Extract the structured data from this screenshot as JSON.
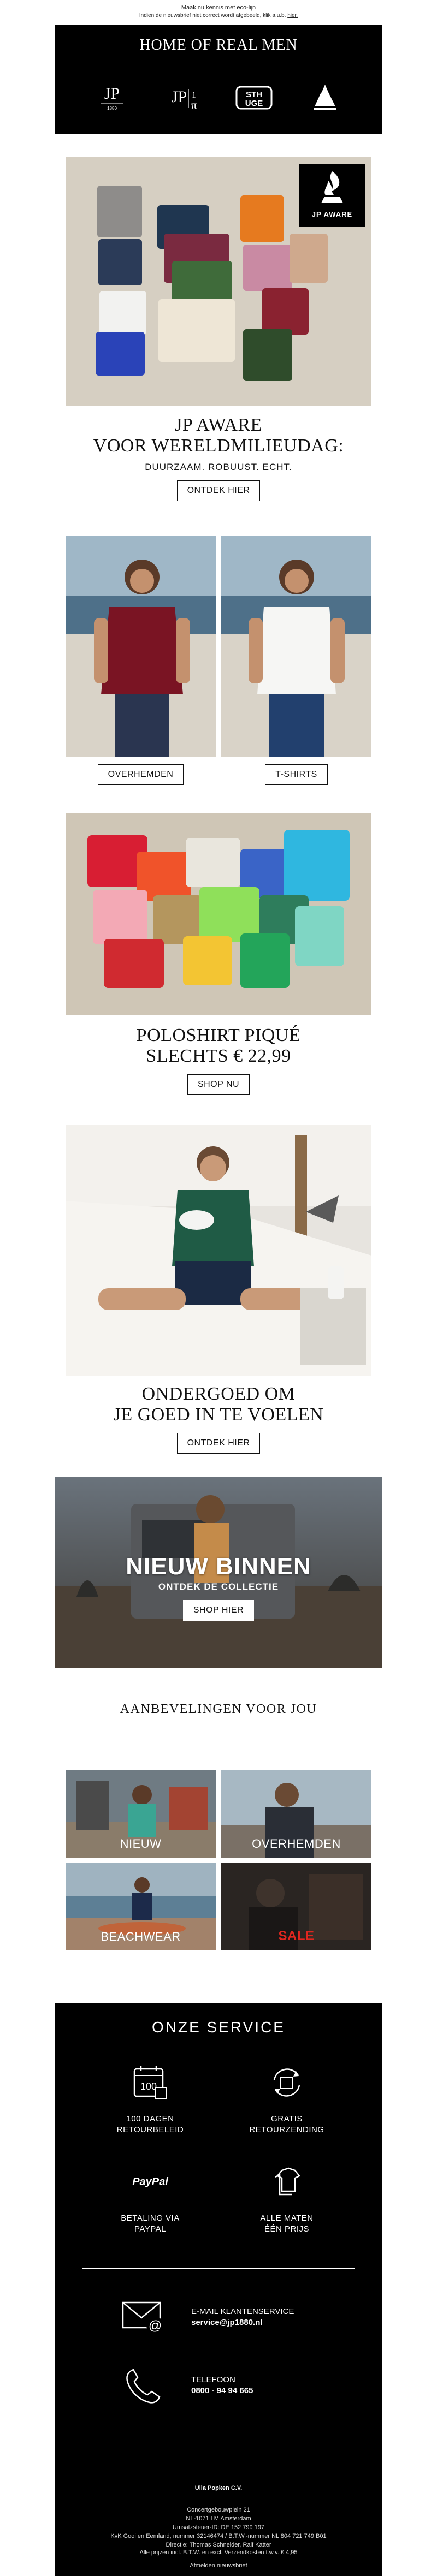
{
  "topbar": {
    "line1": "Maak nu kennis met eco-lijn",
    "line2_prefix": "Indien de nieuwsbrief niet correct wordt afgebeeld, klik a.u.b.",
    "line2_link": "hier."
  },
  "header": {
    "brand": "HOME OF REAL MEN",
    "logos": [
      "JP 1880",
      "JP π",
      "STHUGE",
      "JP AWARE"
    ]
  },
  "promo_aware": {
    "badge": "JP AWARE",
    "title_line1": "JP AWARE",
    "title_line2": "VOOR WERELDMILIEUDAG:",
    "subtitle": "DUURZAAM. ROBUUST. ECHT.",
    "button": "ONTDEK HIER"
  },
  "split_categories": {
    "left_button": "OVERHEMDEN",
    "right_button": "T-SHIRTS"
  },
  "promo_polo": {
    "title_line1": "POLOSHIRT PIQUÉ",
    "title_line2": "SLECHTS € 22,99",
    "button": "SHOP NU"
  },
  "promo_underwear": {
    "title_line1": "ONDERGOED OM",
    "title_line2": "JE GOED IN TE VOELEN",
    "button": "ONTDEK HIER"
  },
  "promo_new": {
    "title": "NIEUW BINNEN",
    "subtitle": "ONTDEK DE COLLECTIE",
    "button": "SHOP HIER"
  },
  "recommendations": {
    "title": "AANBEVELINGEN VOOR JOU",
    "tiles": [
      "NIEUW",
      "OVERHEMDEN",
      "BEACHWEAR",
      "SALE"
    ]
  },
  "service": {
    "title": "ONZE SERVICE",
    "items": [
      {
        "icon": "calendar-100-icon",
        "line1": "100 DAGEN",
        "line2": "RETOURBELEID"
      },
      {
        "icon": "return-box-icon",
        "line1": "GRATIS",
        "line2": "RETOURZENDING"
      },
      {
        "icon": "paypal-icon",
        "line1": "BETALING VIA",
        "line2": "PAYPAL",
        "icon_text": "PayPal"
      },
      {
        "icon": "shirts-icon",
        "line1": "ALLE MATEN",
        "line2": "ÉÉN PRIJS"
      }
    ],
    "email_label": "E-MAIL KLANTENSERVICE",
    "email_value": "service@jp1880.nl",
    "phone_label": "TELEFOON",
    "phone_value": "0800 - 94 94 665",
    "company": "Ulla Popken C.V.",
    "address1": "Concertgebouwplein 21",
    "address2": "NL-1071 LM Amsterdam",
    "address3": "Umsatzsteuer-ID: DE 152 799 197",
    "address4": "KvK Gooi en Eemland, nummer 32146474 / B.T.W.-nummer NL 804 721 749 B01",
    "address5": "Directie: Thomas Schneider, Ralf Katter",
    "prices": "Alle prijzen incl. B.T.W. en excl. Verzendkosten t.w.v. € 4,95",
    "unsubscribe": "Afmelden nieuwsbrief"
  },
  "colors": {
    "black": "#000000",
    "sale_red": "#e0261f"
  }
}
